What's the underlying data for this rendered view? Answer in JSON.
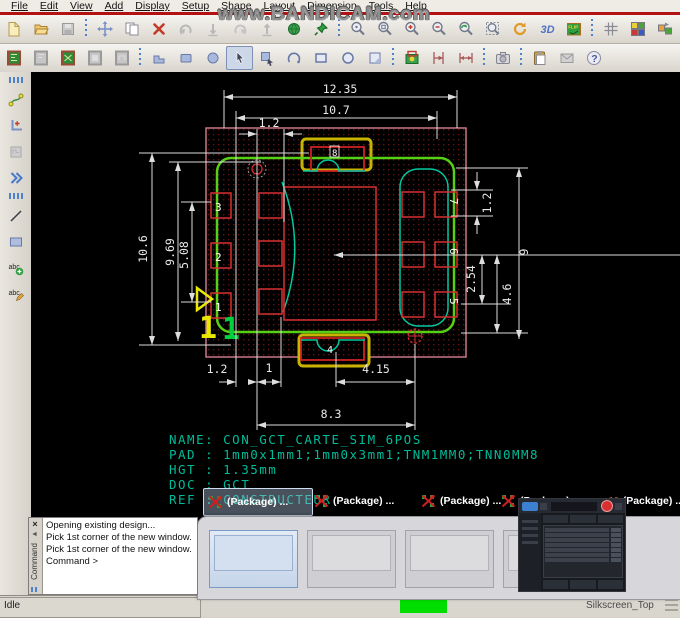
{
  "watermark": "www.BANDICAM.com",
  "menu": {
    "items": [
      "File",
      "Edit",
      "View",
      "Add",
      "Display",
      "Setup",
      "Shape",
      "Layout",
      "Dimension",
      "Tools",
      "Help"
    ]
  },
  "icons": {
    "view_3d": "3D",
    "flip": "FLIP",
    "help": "?",
    "abc_glyph": "abc",
    "close": "×",
    "collapse_arrow": "◄"
  },
  "drawing": {
    "dims": {
      "top_outer": "12.35",
      "top_inner": "10.7",
      "top_pad": "1.2",
      "left_outer": "10.6",
      "left_mid": "9.69",
      "left_inner": "5.08",
      "right_pad": "1.2",
      "right_pitch": "2.54",
      "right_span": "4.6",
      "right_outer": "9",
      "bottom_left": "1.2",
      "bottom_left2": "1",
      "bottom_mid": "4.15",
      "bottom_span": "8.3"
    },
    "pads": {
      "p1": "1",
      "p2": "2",
      "p3": "3",
      "p4": "4",
      "p5": "5",
      "p6": "6",
      "p7": "7",
      "p8": "8"
    },
    "markers": {
      "yellow_one": "1",
      "green_one": "1"
    },
    "info_lines": {
      "name": "NAME: CON_GCT_CARTE_SIM_6POS",
      "pad": "PAD : 1mm0x1mm1;1mm0x3mm1;TNM1MM0;TNN0MM8",
      "hgt": "HGT : 1.35mm",
      "doc": "DOC : GCT",
      "ref": "REF : CONSTRUCTEUR"
    },
    "colors": {
      "courtyard_pink": "#c87888",
      "silkscreen_green": "#55d015",
      "pad_red": "#d03030",
      "assembly_teal": "#00c8a0",
      "dimension_white": "#e0e0e0",
      "text_teal": "#00bb99"
    }
  },
  "taskbar": {
    "items": [
      {
        "label": "(Package) ..."
      },
      {
        "label": "(Package) ..."
      },
      {
        "label": "(Package) ..."
      },
      {
        "label": "(Package) ..."
      },
      {
        "label": "(Package) ..."
      }
    ]
  },
  "command_window": {
    "title": "Command",
    "lines": [
      "Opening existing design...",
      "Pick 1st corner of the new window.",
      "Pick 1st corner of the new window.",
      "Command >"
    ]
  },
  "status_bar": {
    "state": "Idle",
    "layer": "Silkscreen_Top"
  }
}
